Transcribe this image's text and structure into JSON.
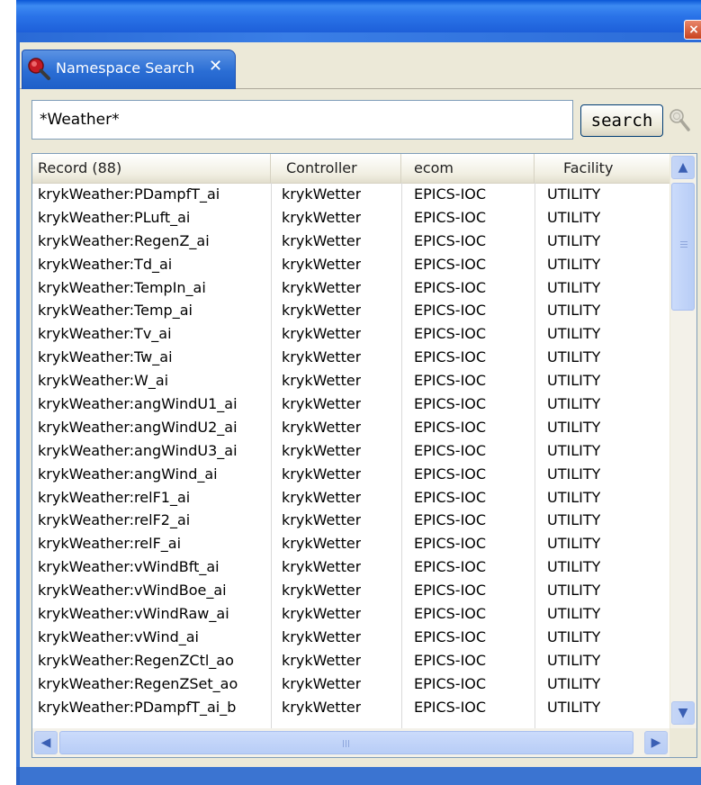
{
  "window": {
    "close_icon": "close-icon",
    "close_glyph": "×"
  },
  "tab": {
    "label": "Namespace Search",
    "icon": "magnifier-icon",
    "close_glyph": "✕"
  },
  "search": {
    "value": "*Weather*",
    "button_label": "search",
    "aux_icon": "magnifier-icon"
  },
  "table": {
    "columns": [
      "Record (88)",
      "Controller",
      "ecom",
      "Facility"
    ],
    "rows": [
      [
        "krykWeather:PDampfT_ai",
        "krykWetter",
        "EPICS-IOC",
        "UTILITY"
      ],
      [
        "krykWeather:PLuft_ai",
        "krykWetter",
        "EPICS-IOC",
        "UTILITY"
      ],
      [
        "krykWeather:RegenZ_ai",
        "krykWetter",
        "EPICS-IOC",
        "UTILITY"
      ],
      [
        "krykWeather:Td_ai",
        "krykWetter",
        "EPICS-IOC",
        "UTILITY"
      ],
      [
        "krykWeather:TempIn_ai",
        "krykWetter",
        "EPICS-IOC",
        "UTILITY"
      ],
      [
        "krykWeather:Temp_ai",
        "krykWetter",
        "EPICS-IOC",
        "UTILITY"
      ],
      [
        "krykWeather:Tv_ai",
        "krykWetter",
        "EPICS-IOC",
        "UTILITY"
      ],
      [
        "krykWeather:Tw_ai",
        "krykWetter",
        "EPICS-IOC",
        "UTILITY"
      ],
      [
        "krykWeather:W_ai",
        "krykWetter",
        "EPICS-IOC",
        "UTILITY"
      ],
      [
        "krykWeather:angWindU1_ai",
        "krykWetter",
        "EPICS-IOC",
        "UTILITY"
      ],
      [
        "krykWeather:angWindU2_ai",
        "krykWetter",
        "EPICS-IOC",
        "UTILITY"
      ],
      [
        "krykWeather:angWindU3_ai",
        "krykWetter",
        "EPICS-IOC",
        "UTILITY"
      ],
      [
        "krykWeather:angWind_ai",
        "krykWetter",
        "EPICS-IOC",
        "UTILITY"
      ],
      [
        "krykWeather:relF1_ai",
        "krykWetter",
        "EPICS-IOC",
        "UTILITY"
      ],
      [
        "krykWeather:relF2_ai",
        "krykWetter",
        "EPICS-IOC",
        "UTILITY"
      ],
      [
        "krykWeather:relF_ai",
        "krykWetter",
        "EPICS-IOC",
        "UTILITY"
      ],
      [
        "krykWeather:vWindBft_ai",
        "krykWetter",
        "EPICS-IOC",
        "UTILITY"
      ],
      [
        "krykWeather:vWindBoe_ai",
        "krykWetter",
        "EPICS-IOC",
        "UTILITY"
      ],
      [
        "krykWeather:vWindRaw_ai",
        "krykWetter",
        "EPICS-IOC",
        "UTILITY"
      ],
      [
        "krykWeather:vWind_ai",
        "krykWetter",
        "EPICS-IOC",
        "UTILITY"
      ],
      [
        "krykWeather:RegenZCtl_ao",
        "krykWetter",
        "EPICS-IOC",
        "UTILITY"
      ],
      [
        "krykWeather:RegenZSet_ao",
        "krykWetter",
        "EPICS-IOC",
        "UTILITY"
      ],
      [
        "krykWeather:PDampfT_ai_b",
        "krykWetter",
        "EPICS-IOC",
        "UTILITY"
      ]
    ]
  },
  "scrollbars": {
    "up_glyph": "▲",
    "down_glyph": "▼",
    "left_glyph": "◀",
    "right_glyph": "▶"
  },
  "colors": {
    "frame_blue": "#2a6ad6",
    "tab_blue": "#2a6dd4",
    "panel_bg": "#ece9d8"
  }
}
